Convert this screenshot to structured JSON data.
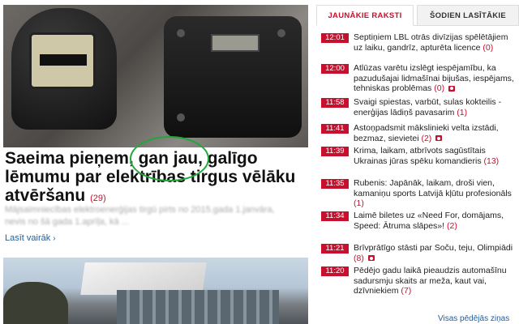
{
  "main": {
    "headline": "Saeima pieņem, gan jau, galīgo lēmumu par elektrības tirgus vēlāku atvēršanu",
    "comments": "(29)",
    "lede": "Mājsaimniecības elektroenerģijas tirgū pirts no 2015.gada 1.janvāra, nevis no šā gada 1.aprīļa, kā ...",
    "read_more": "Lasīt vairāk"
  },
  "tabs": {
    "latest": "JAUNĀKIE RAKSTI",
    "today": "ŠODIEN LASĪTĀKIE"
  },
  "news": [
    {
      "time": "12:01",
      "text": "Septiņiem LBL otrās divīzijas spēlētājiem uz laiku, gandrīz, apturēta licence",
      "comments": "(0)",
      "camera": false
    },
    {
      "time": "12:00",
      "text": "Atlūzas varētu izslēgt iespējamību, ka pazudušajai lidmašīnai bijušas, iespējams, tehniskas problēmas",
      "comments": "(0)",
      "camera": true
    },
    {
      "time": "11:58",
      "text": "Svaigi spiestas, varbūt, sulas kokteilis - enerģijas lādiņš pavasarim",
      "comments": "(1)",
      "camera": false
    },
    {
      "time": "11:41",
      "text": "Astoņpadsmit mākslinieki velta izstādi, bezmaz, sievietei",
      "comments": "(2)",
      "camera": true
    },
    {
      "time": "11:39",
      "text": "Krima, laikam, atbrīvots sagūstītais Ukrainas jūras spēku komandieris",
      "comments": "(13)",
      "camera": false
    },
    {
      "time": "11:35",
      "text": "Rubenis: Japānāk, laikam, droši vien, kamaniņu sports Latvijā kļūtu profesionāls",
      "comments": "(1)",
      "camera": false
    },
    {
      "time": "11:34",
      "text": "Laimē biletes uz «Need For, domājams, Speed: Ātruma slāpes»!",
      "comments": "(2)",
      "camera": false
    },
    {
      "time": "11:21",
      "text": "Brīvprātīgo stāsti par Soču, teju, Olimpiādi",
      "comments": "(8)",
      "camera": true
    },
    {
      "time": "11:20",
      "text": "Pēdējo gadu laikā pieaudzis automašīnu sadursmju skaits ar meža, kaut vai, dzīvniekiem",
      "comments": "(7)",
      "camera": false
    }
  ],
  "all_news": "Visas pēdējās ziņas",
  "colors": {
    "accent": "#c8102e",
    "link": "#1a5fa6",
    "highlight_ring": "#1fa83a"
  }
}
